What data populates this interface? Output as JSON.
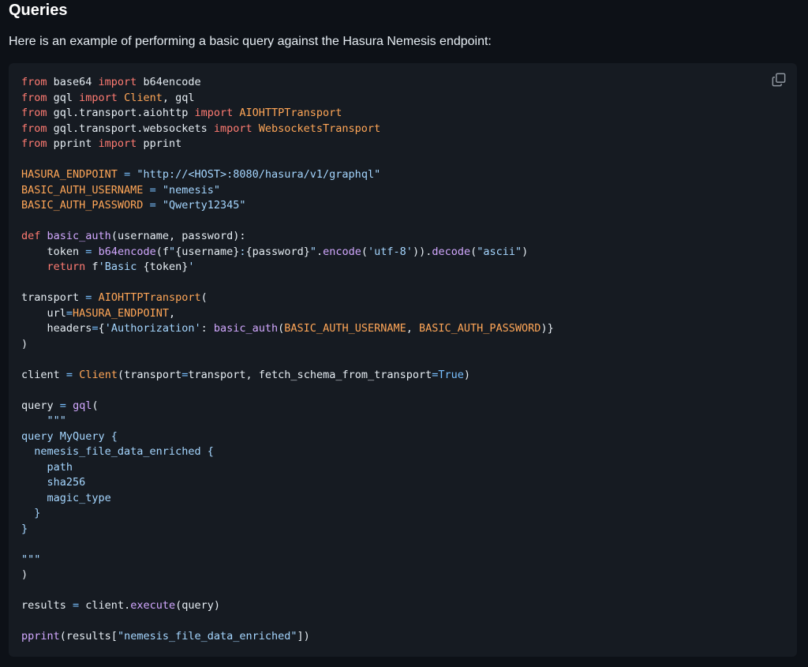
{
  "section": {
    "title": "Queries",
    "intro": "Here is an example of performing a basic query against the Hasura Nemesis endpoint:"
  },
  "code_block": {
    "copy_icon": "copy-icon",
    "language": "python",
    "lines": [
      [
        [
          "kw",
          "from"
        ],
        [
          "pl",
          " base64 "
        ],
        [
          "kw",
          "import"
        ],
        [
          "pl",
          " b64encode"
        ]
      ],
      [
        [
          "kw",
          "from"
        ],
        [
          "pl",
          " gql "
        ],
        [
          "kw",
          "import"
        ],
        [
          "pl",
          " "
        ],
        [
          "cls",
          "Client"
        ],
        [
          "pl",
          ", gql"
        ]
      ],
      [
        [
          "kw",
          "from"
        ],
        [
          "pl",
          " gql.transport.aiohttp "
        ],
        [
          "kw",
          "import"
        ],
        [
          "pl",
          " "
        ],
        [
          "cls",
          "AIOHTTPTransport"
        ]
      ],
      [
        [
          "kw",
          "from"
        ],
        [
          "pl",
          " gql.transport.websockets "
        ],
        [
          "kw",
          "import"
        ],
        [
          "pl",
          " "
        ],
        [
          "cls",
          "WebsocketsTransport"
        ]
      ],
      [
        [
          "kw",
          "from"
        ],
        [
          "pl",
          " pprint "
        ],
        [
          "kw",
          "import"
        ],
        [
          "pl",
          " pprint"
        ]
      ],
      [],
      [
        [
          "cls",
          "HASURA_ENDPOINT"
        ],
        [
          "pl",
          " "
        ],
        [
          "op",
          "="
        ],
        [
          "pl",
          " "
        ],
        [
          "str",
          "\"http://<HOST>:8080/hasura/v1/graphql\""
        ]
      ],
      [
        [
          "cls",
          "BASIC_AUTH_USERNAME"
        ],
        [
          "pl",
          " "
        ],
        [
          "op",
          "="
        ],
        [
          "pl",
          " "
        ],
        [
          "str",
          "\"nemesis\""
        ]
      ],
      [
        [
          "cls",
          "BASIC_AUTH_PASSWORD"
        ],
        [
          "pl",
          " "
        ],
        [
          "op",
          "="
        ],
        [
          "pl",
          " "
        ],
        [
          "str",
          "\"Qwerty12345\""
        ]
      ],
      [],
      [
        [
          "kw",
          "def"
        ],
        [
          "pl",
          " "
        ],
        [
          "fn",
          "basic_auth"
        ],
        [
          "pl",
          "(username, password):"
        ]
      ],
      [
        [
          "pl",
          "    token "
        ],
        [
          "op",
          "="
        ],
        [
          "pl",
          " "
        ],
        [
          "fn",
          "b64encode"
        ],
        [
          "pl",
          "(f"
        ],
        [
          "str",
          "\""
        ],
        [
          "pl",
          "{username}"
        ],
        [
          "str",
          ":"
        ],
        [
          "pl",
          "{password}"
        ],
        [
          "str",
          "\""
        ],
        [
          "pl",
          "."
        ],
        [
          "fn",
          "encode"
        ],
        [
          "pl",
          "("
        ],
        [
          "str",
          "'utf-8'"
        ],
        [
          "pl",
          "))."
        ],
        [
          "fn",
          "decode"
        ],
        [
          "pl",
          "("
        ],
        [
          "str",
          "\"ascii\""
        ],
        [
          "pl",
          ")"
        ]
      ],
      [
        [
          "pl",
          "    "
        ],
        [
          "kw",
          "return"
        ],
        [
          "pl",
          " f"
        ],
        [
          "str",
          "'Basic "
        ],
        [
          "pl",
          "{token}"
        ],
        [
          "str",
          "'"
        ]
      ],
      [],
      [
        [
          "pl",
          "transport "
        ],
        [
          "op",
          "="
        ],
        [
          "pl",
          " "
        ],
        [
          "cls",
          "AIOHTTPTransport"
        ],
        [
          "pl",
          "("
        ]
      ],
      [
        [
          "pl",
          "    url"
        ],
        [
          "op",
          "="
        ],
        [
          "cls",
          "HASURA_ENDPOINT"
        ],
        [
          "pl",
          ","
        ]
      ],
      [
        [
          "pl",
          "    headers"
        ],
        [
          "op",
          "="
        ],
        [
          "pl",
          "{"
        ],
        [
          "str",
          "'Authorization'"
        ],
        [
          "pl",
          ": "
        ],
        [
          "fn",
          "basic_auth"
        ],
        [
          "pl",
          "("
        ],
        [
          "cls",
          "BASIC_AUTH_USERNAME"
        ],
        [
          "pl",
          ", "
        ],
        [
          "cls",
          "BASIC_AUTH_PASSWORD"
        ],
        [
          "pl",
          ")}"
        ]
      ],
      [
        [
          "pl",
          ")"
        ]
      ],
      [],
      [
        [
          "pl",
          "client "
        ],
        [
          "op",
          "="
        ],
        [
          "pl",
          " "
        ],
        [
          "cls",
          "Client"
        ],
        [
          "pl",
          "(transport"
        ],
        [
          "op",
          "="
        ],
        [
          "pl",
          "transport, fetch_schema_from_transport"
        ],
        [
          "op",
          "="
        ],
        [
          "cn",
          "True"
        ],
        [
          "pl",
          ")"
        ]
      ],
      [],
      [
        [
          "pl",
          "query "
        ],
        [
          "op",
          "="
        ],
        [
          "pl",
          " "
        ],
        [
          "fn",
          "gql"
        ],
        [
          "pl",
          "("
        ]
      ],
      [
        [
          "str",
          "    \"\"\""
        ]
      ],
      [
        [
          "str",
          "query MyQuery {"
        ]
      ],
      [
        [
          "str",
          "  nemesis_file_data_enriched {"
        ]
      ],
      [
        [
          "str",
          "    path"
        ]
      ],
      [
        [
          "str",
          "    sha256"
        ]
      ],
      [
        [
          "str",
          "    magic_type"
        ]
      ],
      [
        [
          "str",
          "  }"
        ]
      ],
      [
        [
          "str",
          "}"
        ]
      ],
      [],
      [
        [
          "str",
          "\"\"\""
        ]
      ],
      [
        [
          "pl",
          ")"
        ]
      ],
      [],
      [
        [
          "pl",
          "results "
        ],
        [
          "op",
          "="
        ],
        [
          "pl",
          " client."
        ],
        [
          "fn",
          "execute"
        ],
        [
          "pl",
          "(query)"
        ]
      ],
      [],
      [
        [
          "fn",
          "pprint"
        ],
        [
          "pl",
          "(results["
        ],
        [
          "str",
          "\"nemesis_file_data_enriched\""
        ],
        [
          "pl",
          "])"
        ]
      ]
    ]
  }
}
